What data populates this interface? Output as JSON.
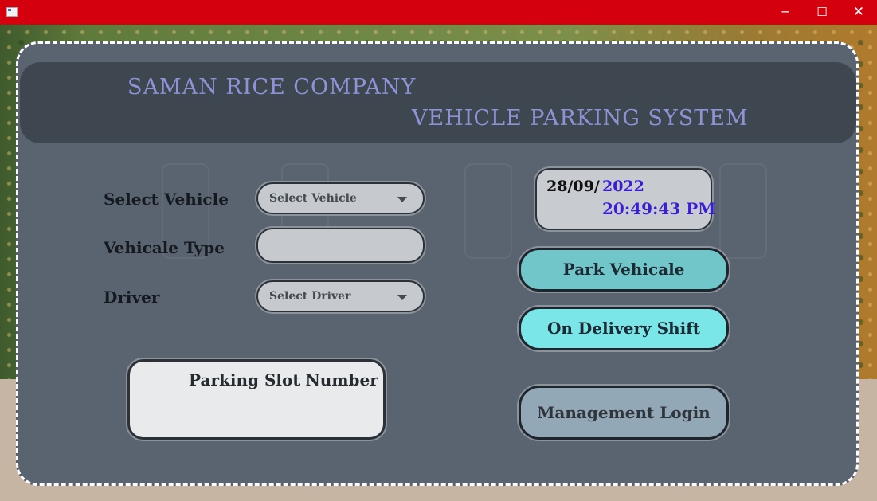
{
  "window": {
    "controls": {
      "minimize": "─",
      "maximize": "☐",
      "close": "✕"
    }
  },
  "header": {
    "company": "SAMAN RICE COMPANY",
    "system": "VEHICLE PARKING SYSTEM"
  },
  "form": {
    "select_vehicle_label": "Select Vehicle",
    "select_vehicle_value": "Select Vehicle",
    "vehicle_type_label": "Vehicale Type",
    "vehicle_type_value": "",
    "driver_label": "Driver",
    "driver_value": "Select  Driver"
  },
  "slot": {
    "label": "Parking Slot Number"
  },
  "clock": {
    "date_day_month": "28/09/",
    "date_year": "2022",
    "time": "20:49:43 PM"
  },
  "buttons": {
    "park": "Park Vehicale",
    "delivery": "On Delivery  Shift",
    "management": "Management Login"
  },
  "colors": {
    "titlebar": "#d4000d",
    "title_text": "#8e93d8",
    "clock_accent": "#3a1ed6",
    "park_button": "#70c6c8",
    "delivery_button": "#7ae6e8",
    "management_button": "#93a8b7"
  },
  "icons": {
    "app": "app-window-icon",
    "dropdown": "chevron-down-icon"
  }
}
